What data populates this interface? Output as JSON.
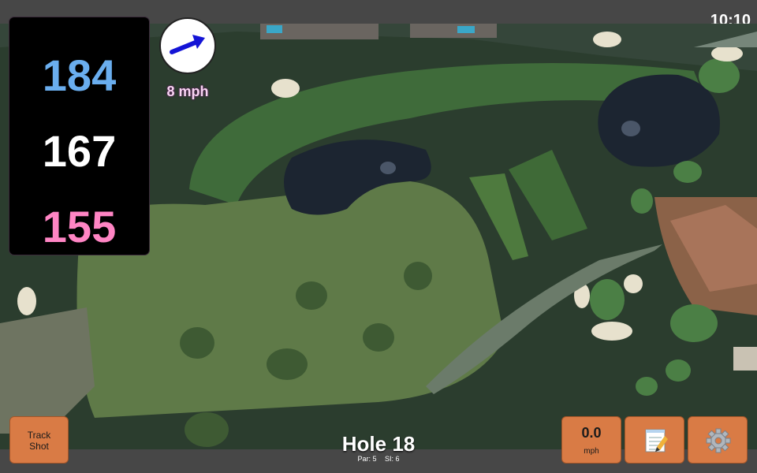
{
  "status_bar": {
    "time": "10:10"
  },
  "distances": {
    "back": "184",
    "middle": "167",
    "front": "155"
  },
  "wind": {
    "speed_label": "8 mph",
    "arrow_icon": "wind-arrow-icon",
    "arrow_color": "#1414d6"
  },
  "hole": {
    "title": "Hole 18",
    "par": "Par: 5",
    "si": "SI: 6"
  },
  "buttons": {
    "track_shot": "Track Shot",
    "speed_value": "0.0",
    "speed_unit": "mph",
    "notes_icon": "notepad-icon",
    "settings_icon": "gear-icon"
  },
  "colors": {
    "accent": "#d97b45",
    "back": "#6aaeef",
    "middle": "#ffffff",
    "front": "#ff85c4"
  }
}
